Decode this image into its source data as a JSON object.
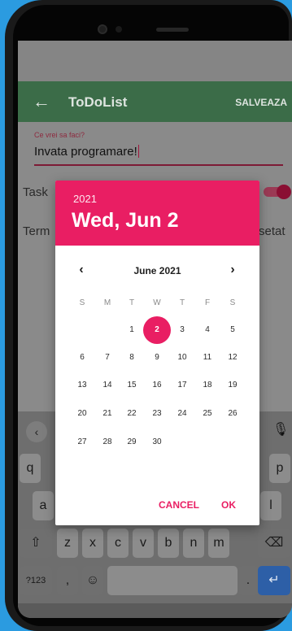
{
  "app": {
    "title": "ToDoList",
    "save_label": "SALVEAZA",
    "back_icon": "arrow-left-icon"
  },
  "form": {
    "task_field_label": "Ce vrei sa faci?",
    "task_field_value": "Invata programare!",
    "row1_label": "Task",
    "row2_label": "Term",
    "row2_trailing": "setat",
    "switch_on": true
  },
  "date_picker": {
    "header_year": "2021",
    "header_date": "Wed, Jun 2",
    "month_label": "June 2021",
    "weekdays": [
      "S",
      "M",
      "T",
      "W",
      "T",
      "F",
      "S"
    ],
    "first_weekday_index": 2,
    "days_in_month": 30,
    "selected_day": 2,
    "cancel_label": "CANCEL",
    "ok_label": "OK",
    "accent_color": "#e91e63"
  },
  "keyboard": {
    "row1_visible": [
      "q",
      "p"
    ],
    "row2_visible": [
      "a",
      "l"
    ],
    "row3": [
      "⇧",
      "z",
      "x",
      "c",
      "v",
      "b",
      "n",
      "m",
      "⌫"
    ],
    "row4": [
      "?123",
      ",",
      "☺",
      ".",
      "↵"
    ],
    "superscripts": {
      "q": "1",
      "p": "0"
    }
  }
}
